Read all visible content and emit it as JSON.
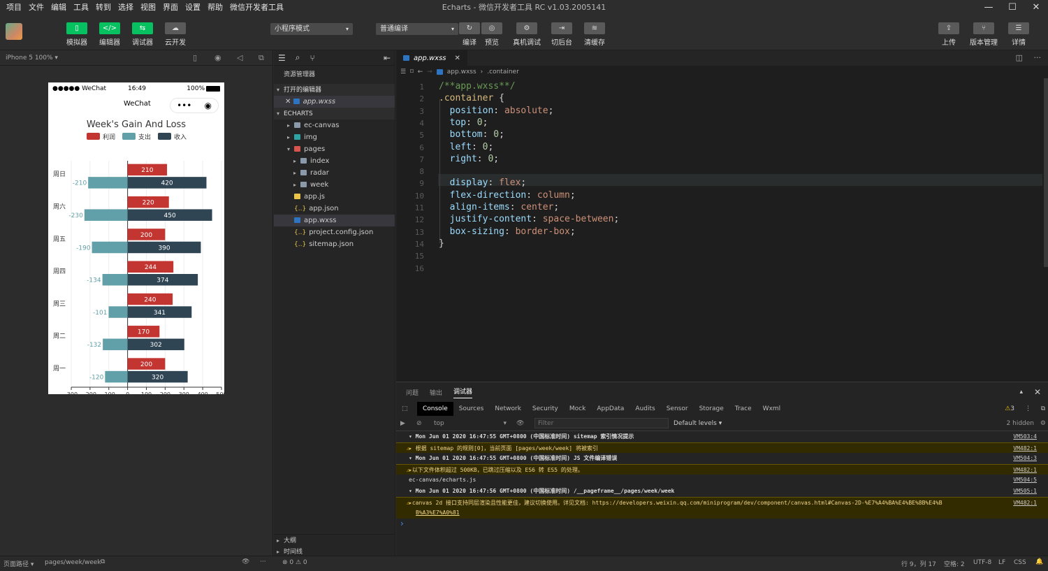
{
  "menubar": {
    "items": [
      "项目",
      "文件",
      "编辑",
      "工具",
      "转到",
      "选择",
      "视图",
      "界面",
      "设置",
      "帮助",
      "微信开发者工具"
    ],
    "window_title": "Echarts - 微信开发者工具 RC v1.03.2005141"
  },
  "toolbar": {
    "left_buttons": [
      {
        "label": "模拟器",
        "icon": "phone-icon"
      },
      {
        "label": "编辑器",
        "icon": "code-icon"
      },
      {
        "label": "调试器",
        "icon": "debug-icon"
      },
      {
        "label": "云开发",
        "icon": "cloud-icon"
      }
    ],
    "mode_select": "小程序模式",
    "compile_select": "普通编译",
    "mid_buttons": [
      {
        "label": "编译",
        "icon": "refresh-icon"
      },
      {
        "label": "预览",
        "icon": "eye-icon"
      },
      {
        "label": "真机调试",
        "icon": "gear-icon"
      },
      {
        "label": "切后台",
        "icon": "switch-icon"
      },
      {
        "label": "清缓存",
        "icon": "layers-icon"
      }
    ],
    "right_buttons": [
      {
        "label": "上传",
        "icon": "upload-icon"
      },
      {
        "label": "版本管理",
        "icon": "branch-icon"
      },
      {
        "label": "详情",
        "icon": "menu-icon"
      }
    ]
  },
  "simulator": {
    "device": "iPhone 5 100% ▾",
    "status": {
      "carrier": "●●●●● WeChat",
      "time": "16:49",
      "battery": "100%"
    },
    "nav_title": "WeChat"
  },
  "chart_data": {
    "type": "bar",
    "orientation": "horizontal",
    "title": "Week's Gain And Loss",
    "legend": [
      "利润",
      "支出",
      "收入"
    ],
    "categories": [
      "周一",
      "周二",
      "周三",
      "周四",
      "周五",
      "周六",
      "周日"
    ],
    "series": [
      {
        "name": "利润",
        "values": [
          200,
          170,
          240,
          244,
          200,
          220,
          210
        ],
        "color": "#c23531"
      },
      {
        "name": "支出",
        "values": [
          -120,
          -132,
          -101,
          -134,
          -190,
          -230,
          -210
        ],
        "color": "#61a0a8"
      },
      {
        "name": "收入",
        "values": [
          320,
          302,
          341,
          374,
          390,
          450,
          420
        ],
        "color": "#2f4554"
      }
    ],
    "xlim": [
      -300,
      500
    ],
    "xticks": [
      "-300",
      "-200",
      "-100",
      "0",
      "100",
      "200",
      "300",
      "400",
      "500"
    ]
  },
  "explorer": {
    "title": "资源管理器",
    "open_editors_label": "打开的编辑器",
    "open_file": "app.wxss",
    "project_label": "ECHARTS",
    "tree": [
      {
        "name": "ec-canvas",
        "type": "folder",
        "depth": 1,
        "fold": "▸"
      },
      {
        "name": "img",
        "type": "folder-img",
        "depth": 1,
        "fold": "▸"
      },
      {
        "name": "pages",
        "type": "folder-red",
        "depth": 1,
        "fold": "▾"
      },
      {
        "name": "index",
        "type": "folder",
        "depth": 2,
        "fold": "▸"
      },
      {
        "name": "radar",
        "type": "folder",
        "depth": 2,
        "fold": "▸"
      },
      {
        "name": "week",
        "type": "folder",
        "depth": 2,
        "fold": "▸"
      },
      {
        "name": "app.js",
        "type": "js",
        "depth": 1,
        "fold": ""
      },
      {
        "name": "app.json",
        "type": "json",
        "depth": 1,
        "fold": ""
      },
      {
        "name": "app.wxss",
        "type": "css",
        "depth": 1,
        "fold": "",
        "active": true
      },
      {
        "name": "project.config.json",
        "type": "json",
        "depth": 1,
        "fold": ""
      },
      {
        "name": "sitemap.json",
        "type": "json",
        "depth": 1,
        "fold": ""
      }
    ],
    "outline_label": "大纲",
    "timeline_label": "时间线"
  },
  "editor": {
    "tab": "app.wxss",
    "breadcrumb": [
      "app.wxss",
      "›",
      ".container"
    ],
    "lines": [
      [
        [
          "cm",
          "/**app.wxss**/"
        ]
      ],
      [
        [
          "sl",
          ".container"
        ],
        [
          "txt",
          " {"
        ]
      ],
      [
        [
          "txt",
          "  "
        ],
        [
          "pr",
          "position"
        ],
        [
          "txt",
          ": "
        ],
        [
          "vl",
          "absolute"
        ],
        [
          "txt",
          ";"
        ]
      ],
      [
        [
          "txt",
          "  "
        ],
        [
          "pr",
          "top"
        ],
        [
          "txt",
          ": "
        ],
        [
          "nm",
          "0"
        ],
        [
          "txt",
          ";"
        ]
      ],
      [
        [
          "txt",
          "  "
        ],
        [
          "pr",
          "bottom"
        ],
        [
          "txt",
          ": "
        ],
        [
          "nm",
          "0"
        ],
        [
          "txt",
          ";"
        ]
      ],
      [
        [
          "txt",
          "  "
        ],
        [
          "pr",
          "left"
        ],
        [
          "txt",
          ": "
        ],
        [
          "nm",
          "0"
        ],
        [
          "txt",
          ";"
        ]
      ],
      [
        [
          "txt",
          "  "
        ],
        [
          "pr",
          "right"
        ],
        [
          "txt",
          ": "
        ],
        [
          "nm",
          "0"
        ],
        [
          "txt",
          ";"
        ]
      ],
      [],
      [
        [
          "txt",
          "  "
        ],
        [
          "pr",
          "display"
        ],
        [
          "txt",
          ": "
        ],
        [
          "vl",
          "flex"
        ],
        [
          "txt",
          ";"
        ]
      ],
      [
        [
          "txt",
          "  "
        ],
        [
          "pr",
          "flex-direction"
        ],
        [
          "txt",
          ": "
        ],
        [
          "vl",
          "column"
        ],
        [
          "txt",
          ";"
        ]
      ],
      [
        [
          "txt",
          "  "
        ],
        [
          "pr",
          "align-items"
        ],
        [
          "txt",
          ": "
        ],
        [
          "vl",
          "center"
        ],
        [
          "txt",
          ";"
        ]
      ],
      [
        [
          "txt",
          "  "
        ],
        [
          "pr",
          "justify-content"
        ],
        [
          "txt",
          ": "
        ],
        [
          "vl",
          "space-between"
        ],
        [
          "txt",
          ";"
        ]
      ],
      [
        [
          "txt",
          "  "
        ],
        [
          "pr",
          "box-sizing"
        ],
        [
          "txt",
          ": "
        ],
        [
          "vl",
          "border-box"
        ],
        [
          "txt",
          ";"
        ]
      ],
      [
        [
          "txt",
          "}"
        ]
      ],
      [],
      []
    ]
  },
  "devtools": {
    "panel_tabs": [
      "问题",
      "输出",
      "调试器"
    ],
    "tabs": [
      "Console",
      "Sources",
      "Network",
      "Security",
      "Mock",
      "AppData",
      "Audits",
      "Sensor",
      "Storage",
      "Trace",
      "Wxml"
    ],
    "warn_count": "3",
    "context": "top",
    "filter_placeholder": "Filter",
    "levels": "Default levels ▾",
    "hidden": "2 hidden",
    "logs": [
      {
        "kind": "grp",
        "text": "▾ Mon Jun 01 2020 16:47:55 GMT+0800 (中国标准时间) sitemap 索引情况提示",
        "src": "VM503:4"
      },
      {
        "kind": "warn",
        "text": "  ▸ 根据 sitemap 的规则[0]，当前页面 [pages/week/week] 将被索引",
        "src": "VM482:1"
      },
      {
        "kind": "grp",
        "text": "▾ Mon Jun 01 2020 16:47:55 GMT+0800 (中国标准时间) JS 文件编译错误",
        "src": "VM504:3"
      },
      {
        "kind": "warn",
        "text": "  ▸以下文件体积超过 500KB，已跳过压缩以及 ES6 转 ES5 的处理。",
        "src": "VM482:1"
      },
      {
        "kind": "plain",
        "text": "  ec-canvas/echarts.js",
        "src": "VM504:5"
      },
      {
        "kind": "grp",
        "text": "▾ Mon Jun 01 2020 16:47:56 GMT+0800 (中国标准时间) /__pageframe__/pages/week/week",
        "src": "VM505:1"
      },
      {
        "kind": "warn",
        "text": "  ▸canvas 2d 接口支持同层渲染且性能更佳，建议切换使用。详见文档: https://developers.weixin.qq.com/miniprogram/dev/component/canvas.html#Canvas-2D-%E7%A4%BA%E4%BE%8B%E4%B",
        "src": "VM482:1"
      },
      {
        "kind": "warn2",
        "text": "B%A3%E7%A0%81",
        "src": ""
      }
    ],
    "prompt": "›"
  },
  "statusbar": {
    "page_path_label": "页面路径 ▾",
    "page_path": "pages/week/week",
    "errors": "⊗ 0 ⚠ 0",
    "cursor": "行 9，列 17",
    "indent": "空格: 2",
    "encoding": "UTF-8",
    "eol": "LF",
    "lang": "CSS"
  }
}
